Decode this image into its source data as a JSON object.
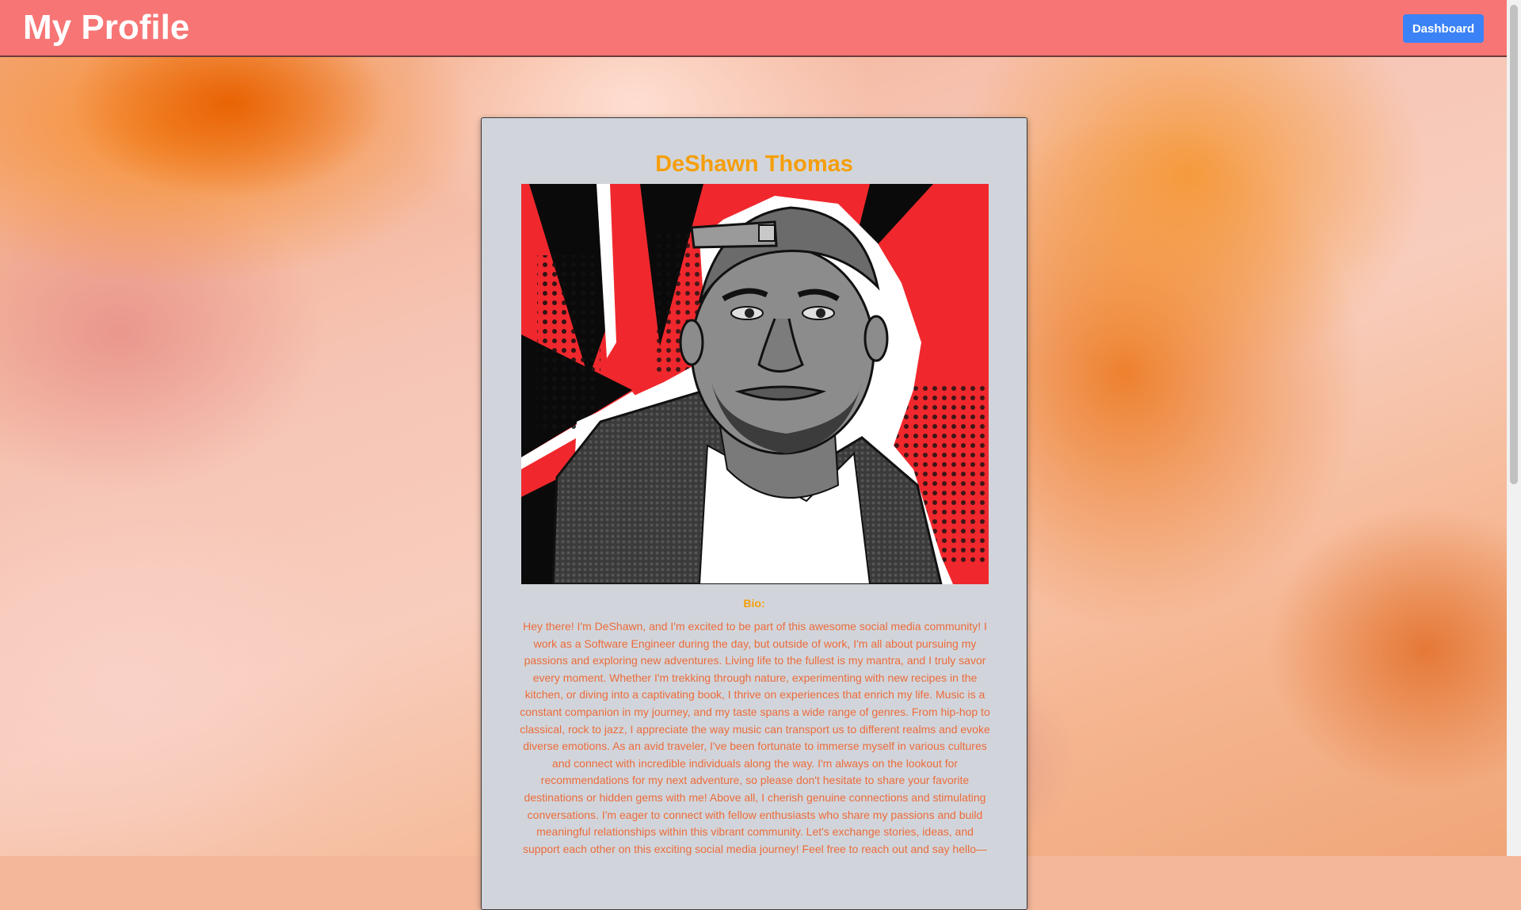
{
  "header": {
    "title": "My Profile",
    "dashboard_label": "Dashboard"
  },
  "profile": {
    "name": "DeShawn Thomas",
    "bio_label": "Bio:",
    "bio": "Hey there! I'm DeShawn, and I'm excited to be part of this awesome social media community! I work as a Software Engineer during the day, but outside of work, I'm all about pursuing my passions and exploring new adventures. Living life to the fullest is my mantra, and I truly savor every moment. Whether I'm trekking through nature, experimenting with new recipes in the kitchen, or diving into a captivating book, I thrive on experiences that enrich my life. Music is a constant companion in my journey, and my taste spans a wide range of genres. From hip-hop to classical, rock to jazz, I appreciate the way music can transport us to different realms and evoke diverse emotions. As an avid traveler, I've been fortunate to immerse myself in various cultures and connect with incredible individuals along the way. I'm always on the lookout for recommendations for my next adventure, so please don't hesitate to share your favorite destinations or hidden gems with me! Above all, I cherish genuine connections and stimulating conversations. I'm eager to connect with fellow enthusiasts who share my passions and build meaningful relationships within this vibrant community. Let's exchange stories, ideas, and support each other on this exciting social media journey! Feel free to reach out and say hello—"
  },
  "colors": {
    "header_bg": "#f87575",
    "button_bg": "#3b82f6",
    "accent_name": "#f59e0b",
    "bio_text": "#ec6b3b",
    "card_bg": "#d1d5db"
  }
}
